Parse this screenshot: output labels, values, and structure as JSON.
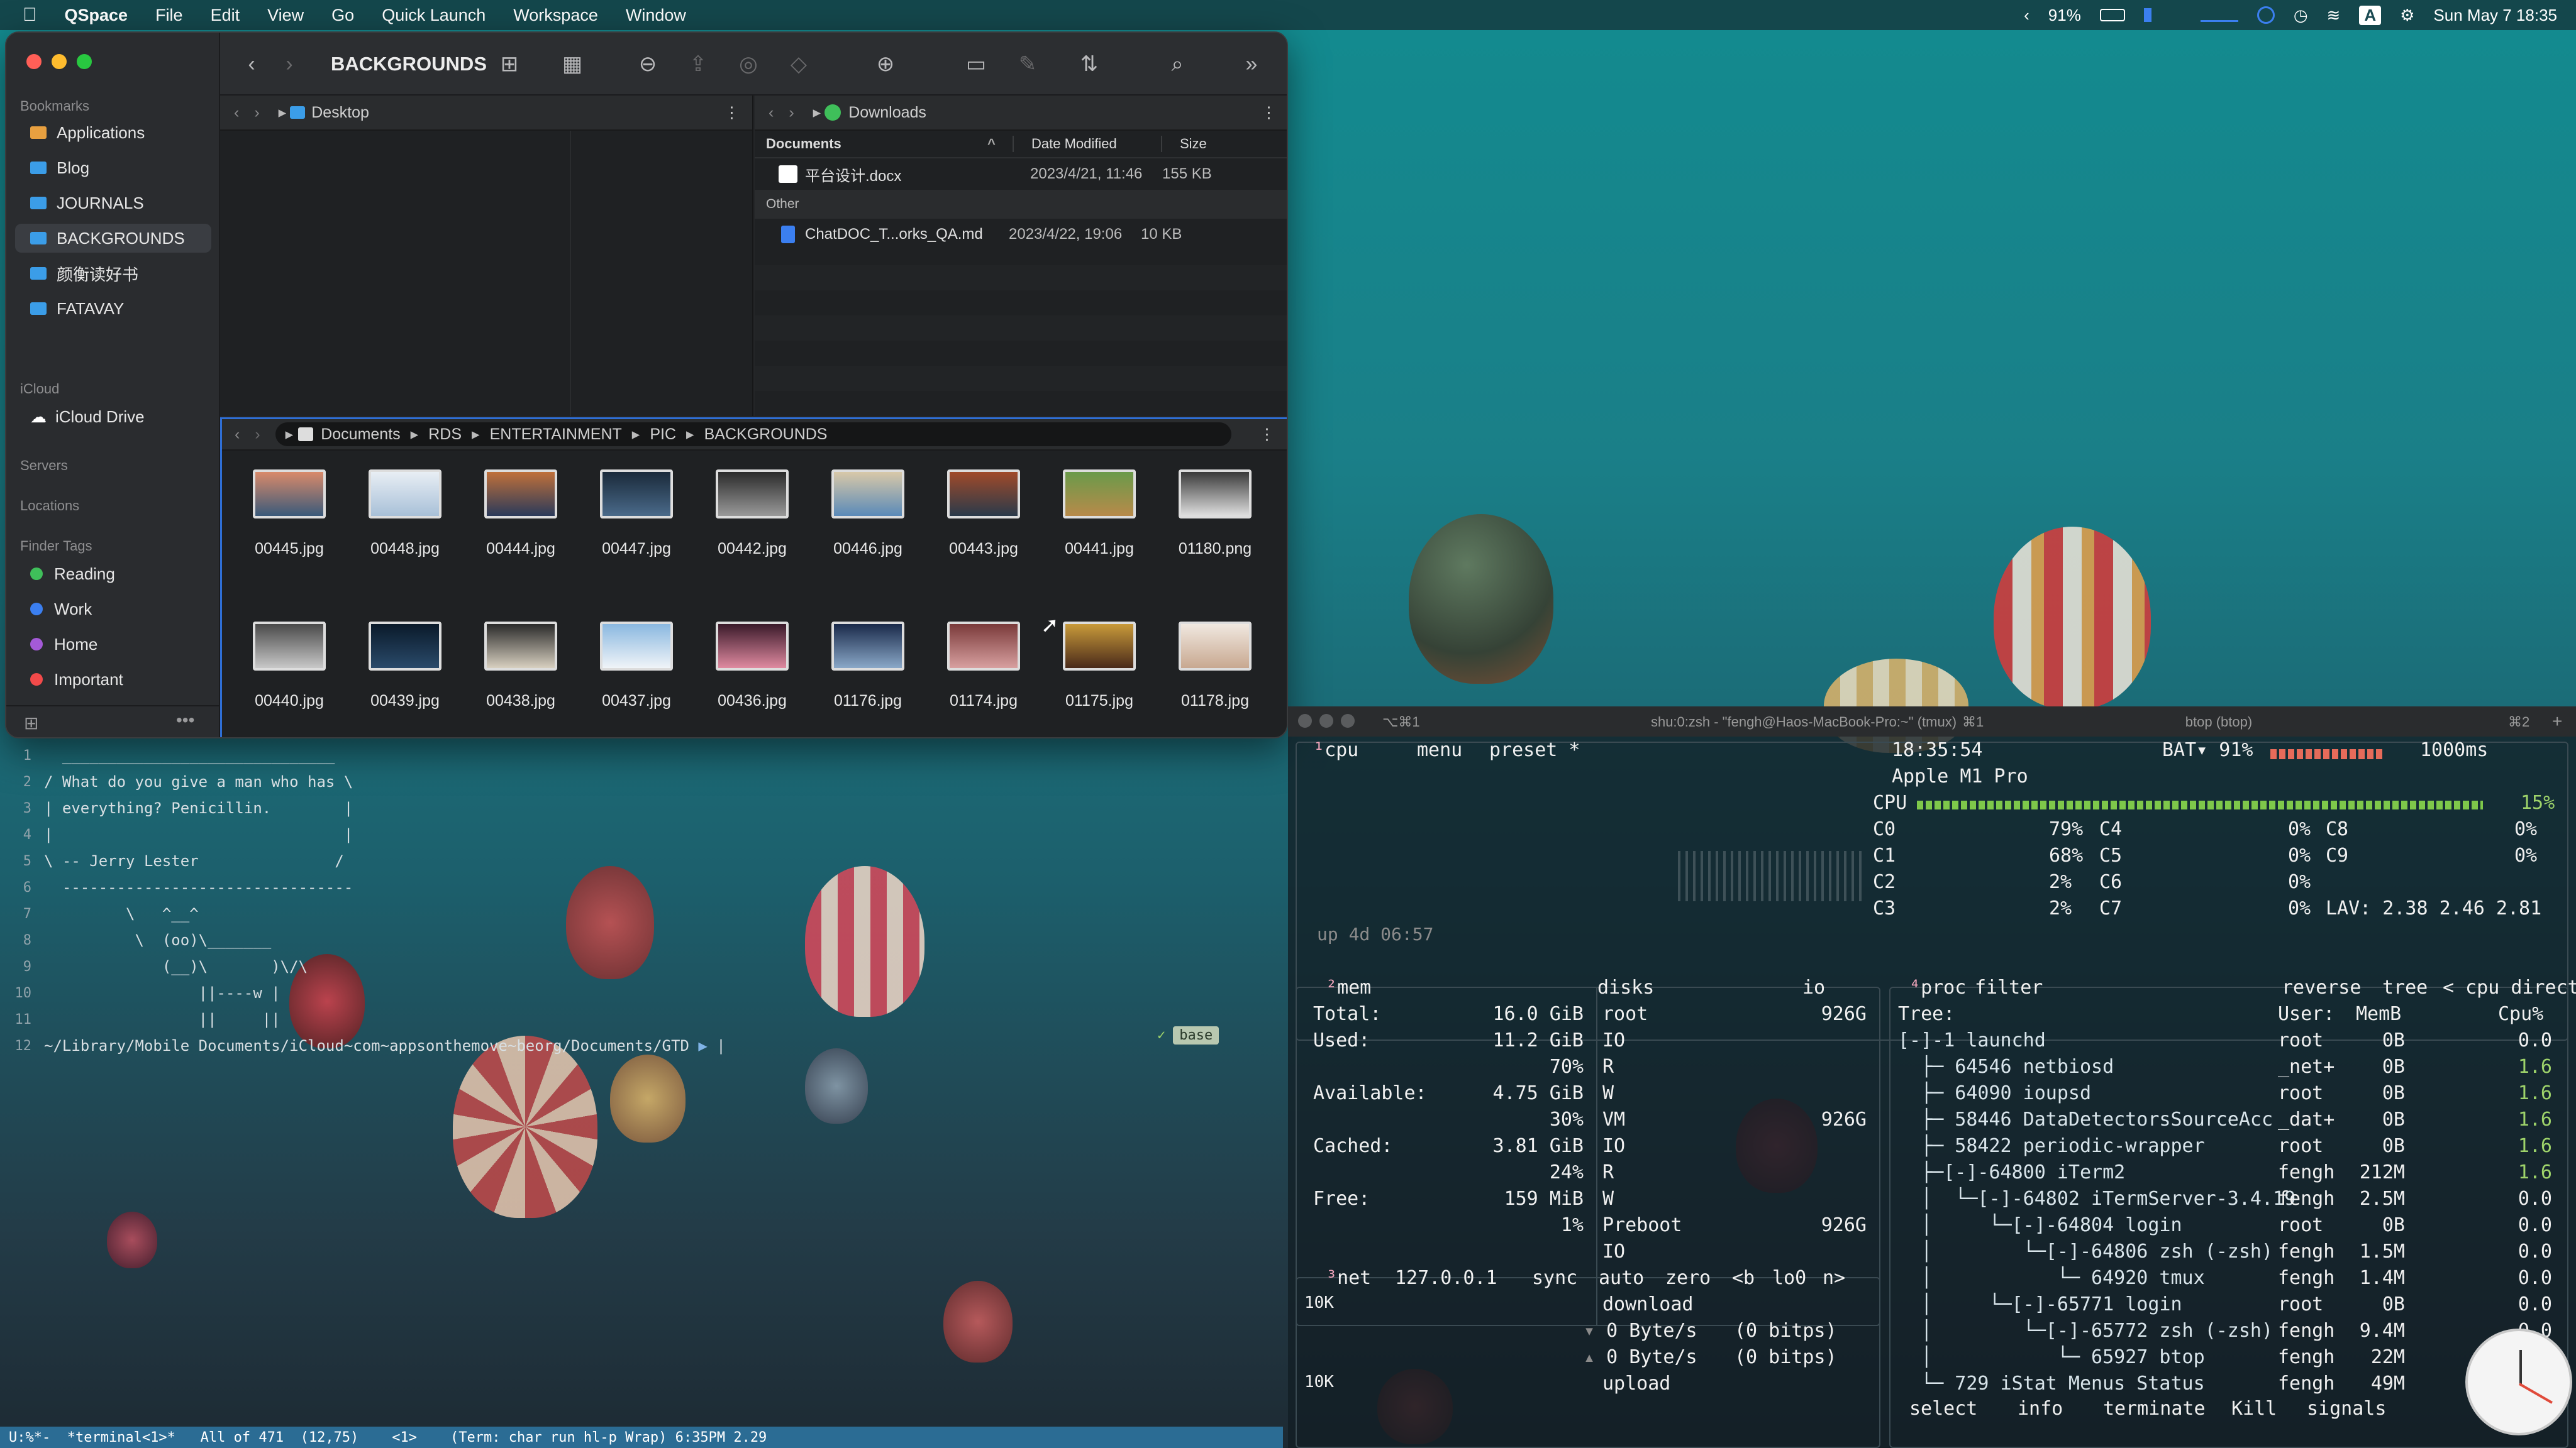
{
  "menubar": {
    "app": "QSpace",
    "items": [
      "File",
      "Edit",
      "View",
      "Go",
      "Quick Launch",
      "Workspace",
      "Window"
    ],
    "battery": "91%",
    "input_source": "A",
    "datetime": "Sun May 7  18:35"
  },
  "qspace": {
    "sidebar": {
      "bookmarks_header": "Bookmarks",
      "bookmarks": [
        "Applications",
        "Blog",
        "JOURNALS",
        "BACKGROUNDS",
        "颜衡读好书",
        "FATAVAY"
      ],
      "icloud_header": "iCloud",
      "icloud_items": [
        "iCloud Drive"
      ],
      "servers_header": "Servers",
      "locations_header": "Locations",
      "tags_header": "Finder Tags",
      "tags": [
        {
          "label": "Reading",
          "color": "#3fbf5a"
        },
        {
          "label": "Work",
          "color": "#3b7ff0"
        },
        {
          "label": "Home",
          "color": "#a45ad8"
        },
        {
          "label": "Important",
          "color": "#f24a4a"
        }
      ]
    },
    "toolbar": {
      "title": "BACKGROUNDS"
    },
    "left_pane": {
      "path": "Desktop"
    },
    "right_pane": {
      "path": "Downloads",
      "columns": [
        "Documents",
        "Date Modified",
        "Size"
      ],
      "group_documents": "Documents",
      "rows_documents": [
        {
          "name": "平台设计.docx",
          "date": "2023/4/21, 11:46",
          "size": "155 KB"
        }
      ],
      "group_other": "Other",
      "rows_other": [
        {
          "name": "ChatDOC_T...orks_QA.md",
          "date": "2023/4/22, 19:06",
          "size": "10 KB"
        }
      ]
    },
    "bottom_pane": {
      "breadcrumb": [
        "Documents",
        "RDS",
        "ENTERTAINMENT",
        "PIC",
        "BACKGROUNDS"
      ],
      "files_row1": [
        "00445.jpg",
        "00448.jpg",
        "00444.jpg",
        "00447.jpg",
        "00442.jpg",
        "00446.jpg",
        "00443.jpg",
        "00441.jpg",
        "01180.png"
      ],
      "files_row2": [
        "00440.jpg",
        "00439.jpg",
        "00438.jpg",
        "00437.jpg",
        "00436.jpg",
        "01176.jpg",
        "01174.jpg",
        "01175.jpg",
        "01178.jpg"
      ]
    }
  },
  "emacs": {
    "lines": [
      {
        "n": "1",
        "t": "  ______________________________"
      },
      {
        "n": "2",
        "t": "/ What do you give a man who has \\"
      },
      {
        "n": "3",
        "t": "| everything? Penicillin.        |"
      },
      {
        "n": "4",
        "t": "|                                |"
      },
      {
        "n": "5",
        "t": "\\ -- Jerry Lester               /"
      },
      {
        "n": "6",
        "t": "  --------------------------------"
      },
      {
        "n": "7",
        "t": "         \\   ^__^"
      },
      {
        "n": "8",
        "t": "          \\  (oo)\\_______"
      },
      {
        "n": "9",
        "t": "             (__)\\       )\\/\\"
      },
      {
        "n": "10",
        "t": "                 ||----w |"
      },
      {
        "n": "11",
        "t": "                 ||     ||"
      },
      {
        "n": "12",
        "t": "~/Library/Mobile Documents/iCloud~com~appsonthemove~beorg/Documents/GTD"
      }
    ],
    "prompt_ok": "✓",
    "prompt_env": "base",
    "modeline": "U:%*-  *terminal<1>*   All of 471  (12,75)    <1>    (Term: char run hl-p Wrap) 6:35PM 2.29"
  },
  "tmux": {
    "tab_left": "⌥⌘1",
    "title": "shu:0:zsh - \"fengh@Haos-MacBook-Pro:~\" (tmux)",
    "tab_mid": "⌘1",
    "btop_title": "btop (btop)",
    "tab_right": "⌘2"
  },
  "btop": {
    "cpu_header": [
      "cpu",
      "menu",
      "preset *"
    ],
    "clock": "18:35:54",
    "battery": "BAT▾ 91%",
    "interval": "1000ms",
    "model": "Apple M1 Pro",
    "cpu_total": "15%",
    "cores": [
      {
        "name": "C0",
        "val": "79%"
      },
      {
        "name": "C4",
        "val": "0%"
      },
      {
        "name": "C8",
        "val": "0%"
      },
      {
        "name": "C1",
        "val": "68%"
      },
      {
        "name": "C5",
        "val": "0%"
      },
      {
        "name": "C9",
        "val": "0%"
      },
      {
        "name": "C2",
        "val": "2%"
      },
      {
        "name": "C6",
        "val": "0%"
      },
      {
        "name": "C3",
        "val": "2%"
      },
      {
        "name": "C7",
        "val": "0%"
      }
    ],
    "lav": "LAV: 2.38 2.46 2.81",
    "uptime": "up 4d 06:57",
    "mem": {
      "title": "mem",
      "total_label": "Total:",
      "total": "16.0 GiB",
      "used_label": "Used:",
      "used": "11.2 GiB",
      "used_pct": "70%",
      "avail_label": "Available:",
      "avail": "4.75 GiB",
      "avail_pct": "30%",
      "cached_label": "Cached:",
      "cached": "3.81 GiB",
      "cached_pct": "24%",
      "free_label": "Free:",
      "free": "159 MiB",
      "free_pct": "1%"
    },
    "disks": {
      "title": "disks",
      "io": "io",
      "root": "root",
      "root_size": "926G",
      "vm": "VM",
      "vm_size": "926G",
      "preboot": "Preboot",
      "preboot_size": "926G",
      "io_label": "IO",
      "r": "R",
      "w": "W"
    },
    "net": {
      "title": "net",
      "iface": "127.0.0.1",
      "opts": [
        "sync",
        "auto",
        "zero",
        "<b",
        "lo0",
        "n>"
      ],
      "scale_top": "10K",
      "scale_bot": "10K",
      "download": "download",
      "down_rate": "0 Byte/s",
      "down_bits": "(0 bitps)",
      "up_rate": "0 Byte/s",
      "up_bits": "(0 bitps)",
      "upload": "upload"
    },
    "proc": {
      "title": "proc",
      "filter": "filter",
      "opts": [
        "reverse",
        "tree",
        "< cpu direct >"
      ],
      "header": [
        "Tree:",
        "User:",
        "MemB",
        "Cpu%"
      ],
      "rows": [
        {
          "tree": "[-]-1 launchd",
          "user": "root",
          "mem": "0B",
          "cpu": "0.0"
        },
        {
          "tree": "  ├─ 64546 netbiosd",
          "user": "_net+",
          "mem": "0B",
          "cpu": "1.6"
        },
        {
          "tree": "  ├─ 64090 ioupsd",
          "user": "root",
          "mem": "0B",
          "cpu": "1.6"
        },
        {
          "tree": "  ├─ 58446 DataDetectorsSourceAcc",
          "user": "_dat+",
          "mem": "0B",
          "cpu": "1.6"
        },
        {
          "tree": "  ├─ 58422 periodic-wrapper",
          "user": "root",
          "mem": "0B",
          "cpu": "1.6"
        },
        {
          "tree": "  ├─[-]-64800 iTerm2",
          "user": "fengh",
          "mem": "212M",
          "cpu": "1.6"
        },
        {
          "tree": "  │  └─[-]-64802 iTermServer-3.4.19",
          "user": "fengh",
          "mem": "2.5M",
          "cpu": "0.0"
        },
        {
          "tree": "  │     └─[-]-64804 login",
          "user": "root",
          "mem": "0B",
          "cpu": "0.0"
        },
        {
          "tree": "  │        └─[-]-64806 zsh (-zsh)",
          "user": "fengh",
          "mem": "1.5M",
          "cpu": "0.0"
        },
        {
          "tree": "  │           └─ 64920 tmux",
          "user": "fengh",
          "mem": "1.4M",
          "cpu": "0.0"
        },
        {
          "tree": "  │     └─[-]-65771 login",
          "user": "root",
          "mem": "0B",
          "cpu": "0.0"
        },
        {
          "tree": "  │        └─[-]-65772 zsh (-zsh)",
          "user": "fengh",
          "mem": "9.4M",
          "cpu": "0.0"
        },
        {
          "tree": "  │           └─ 65927 btop",
          "user": "fengh",
          "mem": "22M",
          "cpu": "0.0"
        },
        {
          "tree": "  └─ 729 iStat Menus Status",
          "user": "fengh",
          "mem": "49M",
          "cpu": "0.0"
        }
      ],
      "footer": [
        "select",
        "info",
        "terminate",
        "Kill",
        "signals"
      ]
    }
  }
}
